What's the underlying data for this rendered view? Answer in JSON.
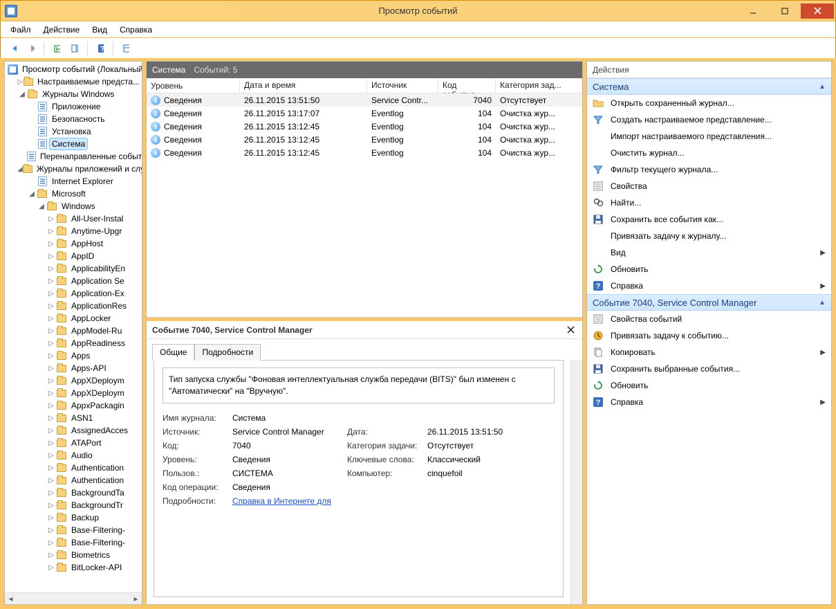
{
  "window": {
    "title": "Просмотр событий"
  },
  "menu": {
    "file": "Файл",
    "action": "Действие",
    "view": "Вид",
    "help": "Справка"
  },
  "tree": {
    "root": "Просмотр событий (Локальный)",
    "customViews": "Настраиваемые предста...",
    "winLogs": {
      "label": "Журналы Windows",
      "app": "Приложение",
      "security": "Безопасность",
      "setup": "Установка",
      "system": "Система",
      "forwarded": "Перенаправленные события"
    },
    "appServices": {
      "label": "Журналы приложений и служб",
      "ie": "Internet Explorer",
      "microsoft": "Microsoft",
      "windows": "Windows"
    },
    "winFolders": [
      "All-User-Instal",
      "Anytime-Upgr",
      "AppHost",
      "AppID",
      "ApplicabilityEn",
      "Application Se",
      "Application-Ex",
      "ApplicationRes",
      "AppLocker",
      "AppModel-Ru",
      "AppReadiness",
      "Apps",
      "Apps-API",
      "AppXDeploym",
      "AppXDeploym",
      "AppxPackagin",
      "ASN1",
      "AssignedAcces",
      "ATAPort",
      "Audio",
      "Authentication",
      "Authentication",
      "BackgroundTa",
      "BackgroundTr",
      "Backup",
      "Base-Filtering-",
      "Base-Filtering-",
      "Biometrics",
      "BitLocker-API"
    ]
  },
  "center": {
    "headerLeft": "Система",
    "headerRight": "Событий: 5",
    "columns": {
      "level": "Уровень",
      "date": "Дата и время",
      "source": "Источник",
      "code": "Код события",
      "category": "Категория зад..."
    },
    "rows": [
      {
        "level": "Сведения",
        "date": "26.11.2015 13:51:50",
        "source": "Service Contr...",
        "code": "7040",
        "category": "Отсутствует",
        "selected": true
      },
      {
        "level": "Сведения",
        "date": "26.11.2015 13:17:07",
        "source": "Eventlog",
        "code": "104",
        "category": "Очистка жур..."
      },
      {
        "level": "Сведения",
        "date": "26.11.2015 13:12:45",
        "source": "Eventlog",
        "code": "104",
        "category": "Очистка жур..."
      },
      {
        "level": "Сведения",
        "date": "26.11.2015 13:12:45",
        "source": "Eventlog",
        "code": "104",
        "category": "Очистка жур..."
      },
      {
        "level": "Сведения",
        "date": "26.11.2015 13:12:45",
        "source": "Eventlog",
        "code": "104",
        "category": "Очистка жур..."
      }
    ]
  },
  "detail": {
    "title": "Событие 7040, Service Control Manager",
    "tabs": {
      "general": "Общие",
      "details": "Подробности"
    },
    "message": "Тип запуска службы \"Фоновая интеллектуальная служба передачи (BITS)\" был изменен с \"Автоматически\" на \"Вручную\".",
    "labels": {
      "logName": "Имя журнала:",
      "source": "Источник:",
      "code": "Код:",
      "level": "Уровень:",
      "user": "Пользов.:",
      "opcode": "Код операции:",
      "moreInfo": "Подробности:",
      "date": "Дата:",
      "taskCategory": "Категория задачи:",
      "keywords": "Ключевые слова:",
      "computer": "Компьютер:"
    },
    "values": {
      "logName": "Система",
      "source": "Service Control Manager",
      "code": "7040",
      "level": "Сведения",
      "user": "СИСТЕМА",
      "opcode": "Сведения",
      "moreInfo": "Справка в Интернете для ",
      "date": "26.11.2015 13:51:50",
      "taskCategory": "Отсутствует",
      "keywords": "Классический",
      "computer": "cinquefoil"
    }
  },
  "actions": {
    "header": "Действия",
    "section1": "Система",
    "section2": "Событие 7040, Service Control Manager",
    "items1": [
      {
        "label": "Открыть сохраненный журнал...",
        "icon": "folder-open"
      },
      {
        "label": "Создать настраиваемое представление...",
        "icon": "filter-new"
      },
      {
        "label": "Импорт настраиваемого представления...",
        "icon": "blank"
      },
      {
        "label": "Очистить журнал...",
        "icon": "blank"
      },
      {
        "label": "Фильтр текущего журнала...",
        "icon": "filter"
      },
      {
        "label": "Свойства",
        "icon": "properties"
      },
      {
        "label": "Найти...",
        "icon": "find"
      },
      {
        "label": "Сохранить все события как...",
        "icon": "save"
      },
      {
        "label": "Привязать задачу к журналу...",
        "icon": "blank"
      },
      {
        "label": "Вид",
        "icon": "blank",
        "hasSubmenu": true
      },
      {
        "label": "Обновить",
        "icon": "refresh"
      },
      {
        "label": "Справка",
        "icon": "help",
        "hasSubmenu": true
      }
    ],
    "items2": [
      {
        "label": "Свойства событий",
        "icon": "properties"
      },
      {
        "label": "Привязать задачу к событию...",
        "icon": "task"
      },
      {
        "label": "Копировать",
        "icon": "copy",
        "hasSubmenu": true
      },
      {
        "label": "Сохранить выбранные события...",
        "icon": "save"
      },
      {
        "label": "Обновить",
        "icon": "refresh"
      },
      {
        "label": "Справка",
        "icon": "help",
        "hasSubmenu": true
      }
    ]
  }
}
